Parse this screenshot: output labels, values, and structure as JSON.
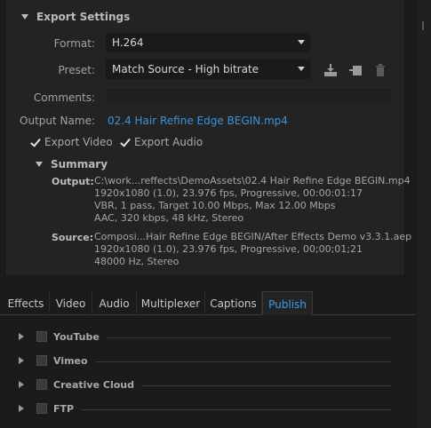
{
  "export_settings": {
    "title": "Export Settings",
    "format_label": "Format:",
    "format_value": "H.264",
    "preset_label": "Preset:",
    "preset_value": "Match Source - High bitrate",
    "comments_label": "Comments:",
    "output_name_label": "Output Name:",
    "output_name_value": "02.4 Hair Refine Edge BEGIN.mp4",
    "export_video_label": "Export Video",
    "export_video_checked": true,
    "export_audio_label": "Export Audio",
    "export_audio_checked": true
  },
  "summary": {
    "title": "Summary",
    "output_label": "Output:",
    "output_lines": [
      "C:\\work...reffects\\DemoAssets\\02.4 Hair Refine Edge BEGIN.mp4",
      "1920x1080 (1.0), 23.976 fps, Progressive, 00:00:01:17",
      "VBR, 1 pass, Target 10.00 Mbps, Max 12.00 Mbps",
      "AAC, 320 kbps, 48 kHz, Stereo"
    ],
    "source_label": "Source:",
    "source_lines": [
      "Composi...Hair Refine Edge BEGIN/After Effects Demo v3.3.1.aep",
      "1920x1080 (1.0), 23.976 fps, Progressive, 00;00;01;21",
      "48000 Hz, Stereo"
    ]
  },
  "tabs": [
    "Effects",
    "Video",
    "Audio",
    "Multiplexer",
    "Captions",
    "Publish"
  ],
  "active_tab": "Publish",
  "publish_items": [
    "YouTube",
    "Vimeo",
    "Creative Cloud",
    "FTP"
  ],
  "icons": {
    "save_preset": "save-preset-icon",
    "import_preset": "import-preset-icon",
    "delete_preset": "trash-icon"
  },
  "colors": {
    "link": "#3a93d9",
    "active_tab": "#3a9ef0"
  }
}
